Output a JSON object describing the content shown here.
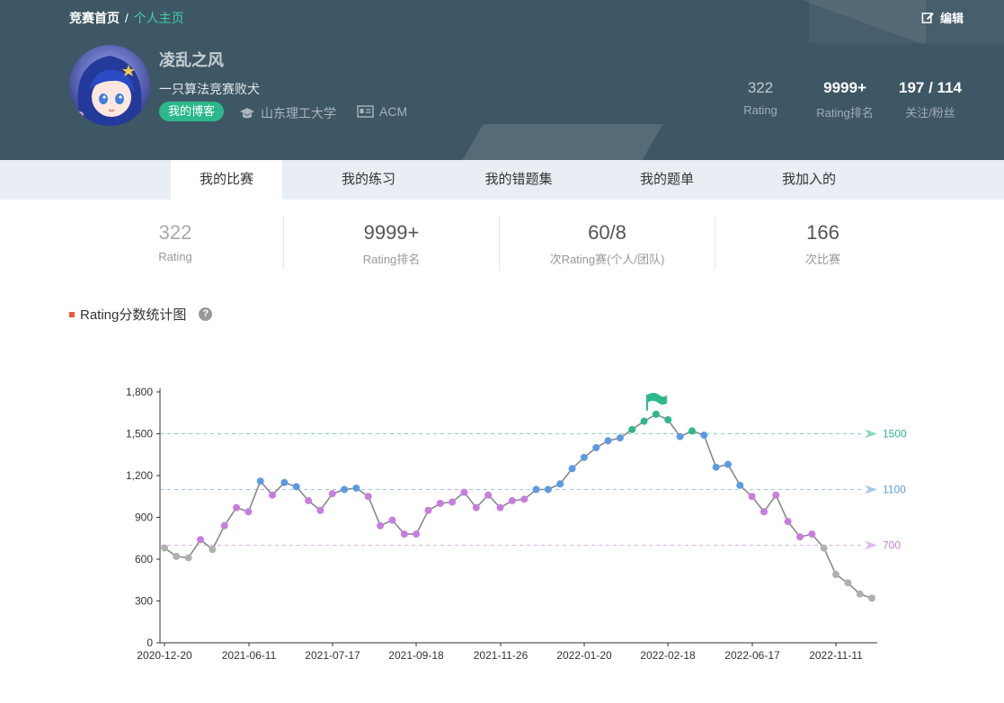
{
  "breadcrumb": {
    "home": "竞赛首页",
    "sep": "/",
    "current": "个人主页"
  },
  "edit_label": "编辑",
  "profile": {
    "name": "凌乱之风",
    "bio": "一只算法竞赛败犬",
    "blog_label": "我的博客",
    "school": "山东理工大学",
    "org": "ACM",
    "school_icon": "graduation-cap-icon",
    "org_icon": "id-card-icon"
  },
  "header_stats": {
    "rating": {
      "value": "322",
      "label": "Rating"
    },
    "rank": {
      "value": "9999+",
      "label": "Rating排名"
    },
    "follow": {
      "value": "197 / 114",
      "label": "关注/粉丝"
    }
  },
  "tabs": [
    "我的比赛",
    "我的练习",
    "我的错题集",
    "我的题单",
    "我加入的"
  ],
  "active_tab": 0,
  "stats": [
    {
      "value": "322",
      "label": "Rating"
    },
    {
      "value": "9999+",
      "label": "Rating排名"
    },
    {
      "value": "60/8",
      "label": "次Rating赛(个人/团队)"
    },
    {
      "value": "166",
      "label": "次比赛"
    }
  ],
  "section_title": "Rating分数统计图",
  "help_icon": "question-circle-icon",
  "colors": {
    "accent": "#2bb88b",
    "header_bg": "#3e5765",
    "link": "#3fd2a6",
    "title_mark": "#f0573c"
  },
  "chart_data": {
    "type": "line",
    "title": "",
    "xlabel": "",
    "ylabel": "",
    "ylim": [
      0,
      1800
    ],
    "yticks": [
      "0",
      "300",
      "600",
      "900",
      "1,200",
      "1,500",
      "1,800"
    ],
    "xtick_labels": [
      "2020-12-20",
      "2021-06-11",
      "2021-07-17",
      "2021-09-18",
      "2021-11-26",
      "2022-01-20",
      "2022-02-18",
      "2022-06-17",
      "2022-11-11"
    ],
    "thresholds": [
      {
        "value": 1500,
        "label": "1500",
        "color": "#2bb88b"
      },
      {
        "value": 1100,
        "label": "1100",
        "color": "#5b9be6"
      },
      {
        "value": 700,
        "label": "700",
        "color": "#c77de0"
      }
    ],
    "series": [
      {
        "values": [
          680,
          620,
          610,
          740,
          670,
          840,
          970,
          940,
          1160,
          1060,
          1150,
          1120,
          1020,
          950,
          1070,
          1100,
          1110,
          1050,
          840,
          880,
          780,
          780,
          950,
          1000,
          1010,
          1080,
          970,
          1060,
          970,
          1020,
          1030,
          1100,
          1100,
          1140,
          1250,
          1330,
          1400,
          1450,
          1470,
          1530,
          1590,
          1640,
          1600,
          1480,
          1520,
          1490,
          1260,
          1280,
          1130,
          1050,
          940,
          1060,
          870,
          760,
          780,
          680,
          490,
          430,
          350,
          320
        ]
      }
    ],
    "peak_marker": "flag-icon"
  }
}
